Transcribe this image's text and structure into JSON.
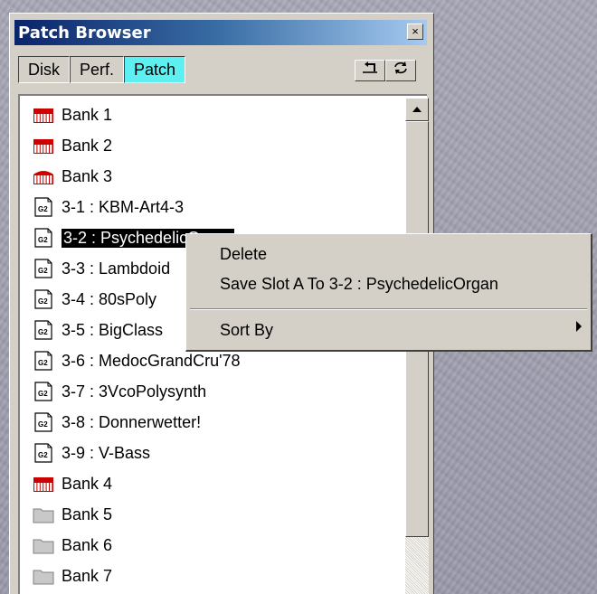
{
  "window": {
    "title": "Patch Browser",
    "close_label": "×"
  },
  "tabs": [
    {
      "label": "Disk",
      "active": false
    },
    {
      "label": "Perf.",
      "active": false
    },
    {
      "label": "Patch",
      "active": true
    }
  ],
  "toolbar": {
    "up_icon": "up-level-icon",
    "refresh_icon": "refresh-icon"
  },
  "list": {
    "items": [
      {
        "label": "Bank 1",
        "icon": "bank-keyboard-icon"
      },
      {
        "label": "Bank 2",
        "icon": "bank-keyboard-icon"
      },
      {
        "label": "Bank 3",
        "icon": "bank-keyboard-open-icon"
      },
      {
        "label": "3-1 : KBM-Art4-3",
        "icon": "g2-patch-icon"
      },
      {
        "label": "3-2 : PsychedelicOrgan",
        "icon": "g2-patch-icon",
        "selected": true
      },
      {
        "label": "3-3 : Lambdoid",
        "icon": "g2-patch-icon"
      },
      {
        "label": "3-4 : 80sPoly",
        "icon": "g2-patch-icon"
      },
      {
        "label": "3-5 : BigClass",
        "icon": "g2-patch-icon"
      },
      {
        "label": "3-6 : MedocGrandCru'78",
        "icon": "g2-patch-icon"
      },
      {
        "label": "3-7 : 3VcoPolysynth",
        "icon": "g2-patch-icon"
      },
      {
        "label": "3-8 : Donnerwetter!",
        "icon": "g2-patch-icon"
      },
      {
        "label": "3-9 : V-Bass",
        "icon": "g2-patch-icon"
      },
      {
        "label": "Bank 4",
        "icon": "bank-keyboard-icon"
      },
      {
        "label": "Bank 5",
        "icon": "folder-icon"
      },
      {
        "label": "Bank 6",
        "icon": "folder-icon"
      },
      {
        "label": "Bank 7",
        "icon": "folder-icon"
      }
    ]
  },
  "context_menu": {
    "delete": "Delete",
    "save": "Save Slot A To 3-2 : PsychedelicOrgan",
    "sort_by": "Sort By"
  },
  "colors": {
    "active_tab": "#5ef0f0",
    "title_bar_start": "#0a246a",
    "bank_red": "#cc0000",
    "selection": "#000000"
  }
}
